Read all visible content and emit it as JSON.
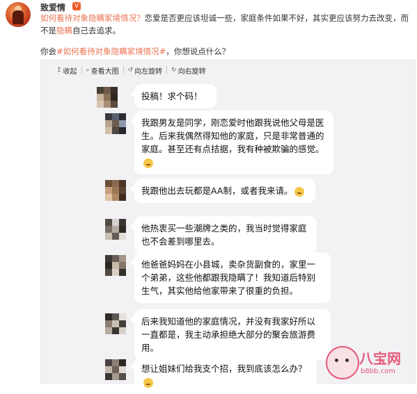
{
  "post": {
    "username": "致爱情",
    "vip_badge": "V",
    "text_link": "如何看待对象隐瞒家境情况？",
    "text_rest_1": "恋爱是否更应该坦诚一些，家庭条件如果不好，其实更应该努力去改变，而不是",
    "text_hl": "隐瞒",
    "text_rest_2": "自己去追求。",
    "ask_prefix": "你会",
    "ask_tag": "#如何看待对象隐瞒家境情况#",
    "ask_suffix": "，你想说点什么？"
  },
  "toolbar": {
    "collapse_label": "收起",
    "view_large_label": "查看大图",
    "rotate_left_label": "向左旋转",
    "rotate_right_label": "向右旋转"
  },
  "messages": [
    {
      "text": "投稿！求个码！",
      "emoji": ""
    },
    {
      "text": "我跟男友是同学，刚恋爱时他跟我说他父母是医生。后来我偶然得知他的家庭，只是非常普通的家庭。甚至还有点拮据，我有种被欺骗的感觉。",
      "emoji": "face-emoji"
    },
    {
      "text": "我跟他出去玩都是AA制，或者我来请。",
      "emoji": "face-emoji"
    },
    {
      "text": "他热衷买一些潮牌之类的，我当时觉得家庭也不会差到哪里去。",
      "emoji": ""
    },
    {
      "text": "他爸爸妈妈在小县城，卖杂货副食的，家里一个弟弟，这些他都跟我隐瞒了！我知道后特别生气，其实他给他家带来了很重的负担。",
      "emoji": ""
    },
    {
      "text": "后来我知道他的家庭情况，并没有我家好所以一直都是，我主动承担绝大部分的聚会旅游费用。",
      "emoji": ""
    },
    {
      "text": "想让姐妹们给我支个招，我到底该怎么办？",
      "emoji": "face-emoji"
    }
  ],
  "watermark": {
    "brand": "八宝网",
    "url": "b8bb.com"
  },
  "icons": {
    "collapse": "collapse-icon",
    "view_large": "magnifier-icon",
    "rotate_left": "rotate-left-icon",
    "rotate_right": "rotate-right-icon"
  },
  "colors": {
    "link": "#eb7350",
    "panel_bg": "#f2f2f5",
    "bubble_bg": "#ffffff",
    "brand": "#e35a78"
  }
}
